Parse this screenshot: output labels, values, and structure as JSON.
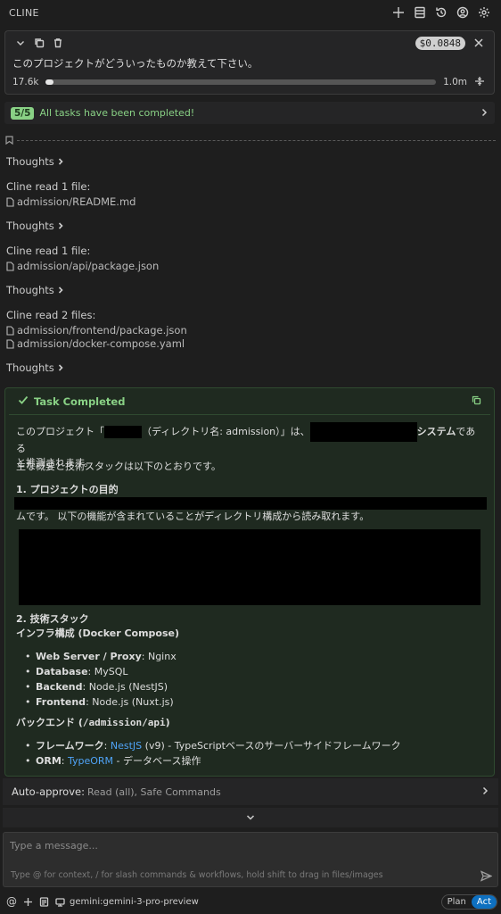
{
  "header": {
    "title": "CLINE"
  },
  "task": {
    "text": "このプロジェクトがどういったものか教えて下さい。",
    "cost": "$0.0848",
    "context_used": "17.6k",
    "context_max": "1.0m",
    "context_fraction": 0.02
  },
  "tasks_done": {
    "badge": "5/5",
    "text": "All tasks have been completed!"
  },
  "chat": {
    "thoughts_label": "Thoughts",
    "read1": {
      "head": "Cline read 1 file:",
      "files": [
        "admission/README.md"
      ]
    },
    "read2": {
      "head": "Cline read 1 file:",
      "files": [
        "admission/api/package.json"
      ]
    },
    "read3": {
      "head": "Cline read 2 files:",
      "files": [
        "admission/frontend/package.json",
        "admission/docker-compose.yaml"
      ]
    }
  },
  "completed": {
    "title": "Task Completed",
    "p1_a": "このプロジェクト「",
    "p1_b": "（ディレクトリ名: admission）」は、",
    "p1_c": "システム",
    "p1_d": "である",
    "p1_e": "と推測されます。",
    "p2": "主な概要と技術スタックは以下のとおりです。",
    "h1": "1. プロジェクトの目的",
    "p3": "ムです。 以下の機能が含まれていることがディレクトリ構成から読み取れます。",
    "h2": "2. 技術スタック",
    "h3": "インフラ構成 (Docker Compose)",
    "infra": [
      {
        "k": "Web Server / Proxy",
        "v": ": Nginx"
      },
      {
        "k": "Database",
        "v": ": MySQL"
      },
      {
        "k": "Backend",
        "v": ": Node.js (NestJS)"
      },
      {
        "k": "Frontend",
        "v": ": Node.js (Nuxt.js)"
      }
    ],
    "h4_a": "バックエンド (",
    "h4_b": "/admission/api",
    "h4_c": ")",
    "backend": [
      {
        "k": "フレームワーク",
        "link": "NestJS",
        "v": " (v9) - TypeScriptベースのサーバーサイドフレームワーク"
      },
      {
        "k": "ORM",
        "link": "TypeORM",
        "v": " - データベース操作"
      }
    ]
  },
  "auto_approve": {
    "label": "Auto-approve:",
    "value": "Read (all), Safe Commands"
  },
  "input": {
    "placeholder": "Type a message...",
    "hint": "Type @ for context, / for slash commands & workflows, hold shift to drag in files/images"
  },
  "bottom": {
    "model": "gemini:gemini-3-pro-preview",
    "plan": "Plan",
    "act": "Act"
  }
}
